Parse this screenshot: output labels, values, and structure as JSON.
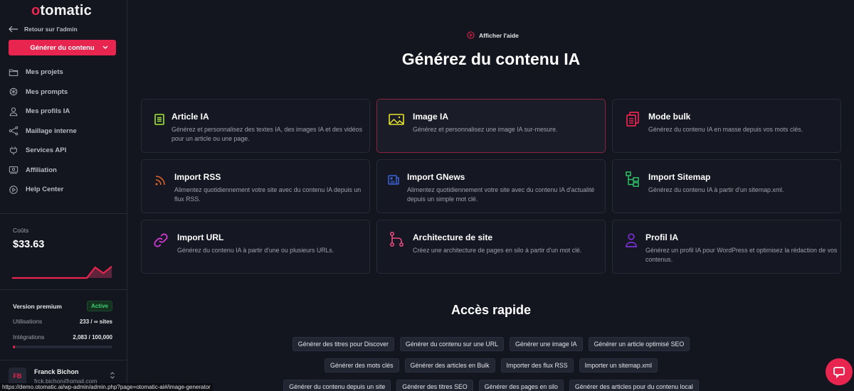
{
  "brand": {
    "logo_first": "o",
    "logo_rest": "tomatic",
    "accent": "#e8254f"
  },
  "sidebar": {
    "back_label": "Retour sur l'admin",
    "primary_button": "Générer du contenu",
    "items": [
      {
        "label": "Mes projets",
        "icon": "folder-icon"
      },
      {
        "label": "Mes prompts",
        "icon": "openai-icon"
      },
      {
        "label": "Mes profils IA",
        "icon": "user-icon"
      },
      {
        "label": "Maillage interne",
        "icon": "share-icon"
      },
      {
        "label": "Services API",
        "icon": "plug-icon"
      },
      {
        "label": "Affiliation",
        "icon": "money-icon"
      },
      {
        "label": "Help Center",
        "icon": "play-circle-icon"
      }
    ],
    "costs": {
      "label": "Coûts",
      "value": "$33.63",
      "trend": [
        0,
        0,
        0,
        0,
        0,
        0,
        0,
        0,
        0,
        0,
        0.55,
        0.25,
        0.6
      ]
    },
    "plan": {
      "label": "Version premium",
      "status": "Active",
      "usage_label": "Utilisations",
      "usage_value": "233 / ∞ sites",
      "integrations_label": "Intégrations",
      "integrations_value": "2,083 / 100,000",
      "integrations_fraction": 0.02083
    },
    "user": {
      "initials": "FB",
      "name": "Franck Bichon",
      "email": "frck.bichon@gmail.com"
    }
  },
  "main": {
    "help_label": "Afficher l'aide",
    "title": "Générez du contenu IA",
    "cards": [
      {
        "title": "Article IA",
        "desc": "Générez et personnalisez des textes IA, des images IA et des vidéos pour un article ou une page.",
        "icon": "document-icon",
        "color": "#a3e635"
      },
      {
        "title": "Image IA",
        "desc": "Générez et personnalisez une image IA sur-mesure.",
        "icon": "image-icon",
        "color": "#e5e52b",
        "active": true
      },
      {
        "title": "Mode bulk",
        "desc": "Générez du contenu IA en masse depuis vos mots clés.",
        "icon": "copy-icon",
        "color": "#e8254f"
      },
      {
        "title": "Import RSS",
        "desc": "Alimentez quotidiennement votre site avec du contenu IA depuis un flux RSS.",
        "icon": "rss-icon",
        "color": "#e0632a"
      },
      {
        "title": "Import GNews",
        "desc": "Alimentez quotidiennement votre site avec du contenu IA d'actualité depuis un simple mot clé.",
        "icon": "newspaper-icon",
        "color": "#3b63d6"
      },
      {
        "title": "Import Sitemap",
        "desc": "Générez du contenu IA à partir d'un sitemap.xml.",
        "icon": "sitemap-icon",
        "color": "#2fc467"
      },
      {
        "title": "Import URL",
        "desc": "Générez du contenu IA à partir d'une ou plusieurs URLs.",
        "icon": "link-icon",
        "color": "#d43ad4"
      },
      {
        "title": "Architecture de site",
        "desc": "Créez une architecture de pages en silo à partir d'un mot clé.",
        "icon": "branch-icon",
        "color": "#e84a7f"
      },
      {
        "title": "Profil IA",
        "desc": "Générez un profil IA pour WordPress et optimisez la rédaction de vos contenus.",
        "icon": "user-icon",
        "color": "#7c2fd6"
      }
    ],
    "quick_access": {
      "title": "Accès rapide",
      "rows": [
        [
          "Générer des titres pour Discover",
          "Générer du contenu sur une URL",
          "Générer une image IA",
          "Générer un article optimisé SEO"
        ],
        [
          "Générer des mots clés",
          "Générer des articles en Bulk",
          "Importer des flux RSS",
          "Importer un sitemap.xml"
        ],
        [
          "Générer du contenu depuis un site",
          "Générer des titres SEO",
          "Générer des pages en silo",
          "Générer des articles pour du contenu local"
        ]
      ]
    }
  },
  "statusbar": {
    "url": "https://demo.otomatic.ai/wp-admin/admin.php?page=otomatic-ai#/image-generator"
  }
}
